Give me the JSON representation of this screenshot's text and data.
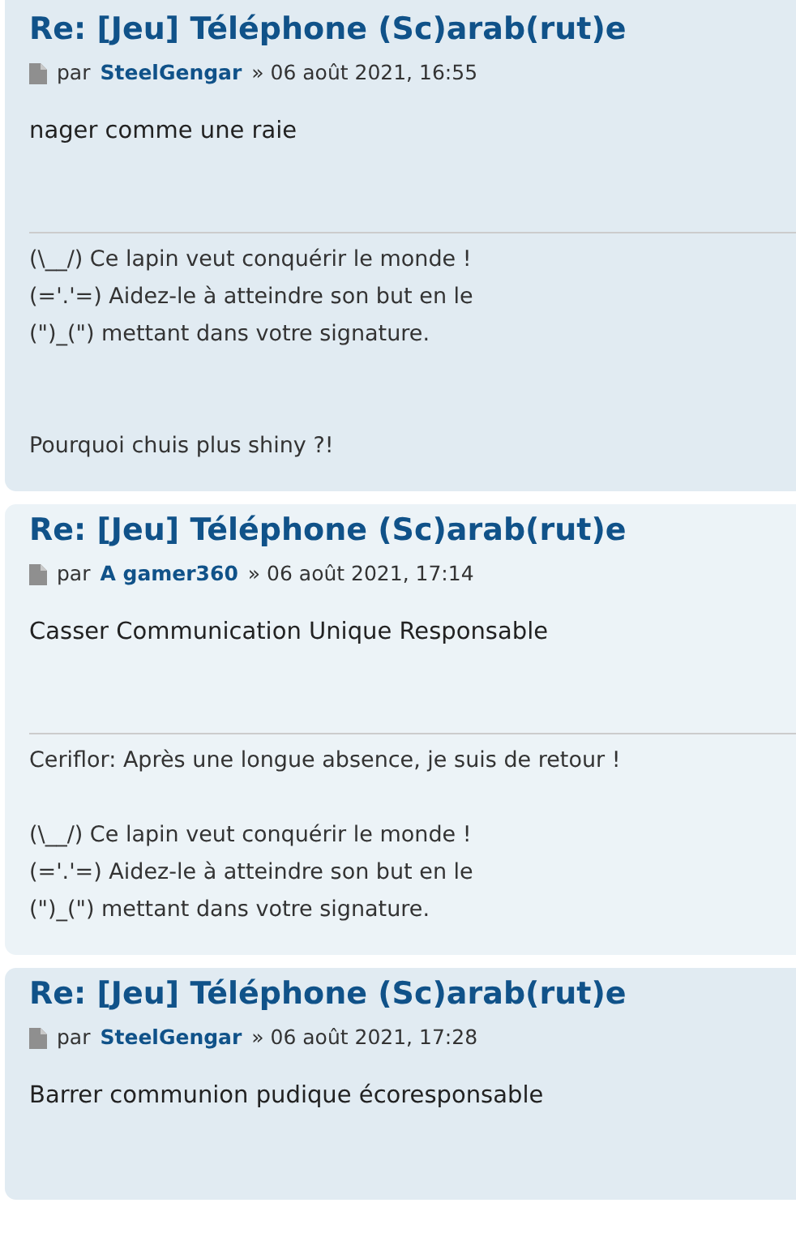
{
  "posts": [
    {
      "color": "#e1ebf2",
      "title": "Re: [Jeu] Téléphone (Sc)arab(rut)e",
      "by": "par",
      "author": "SteelGengar",
      "date": "» 06 août 2021, 16:55",
      "body": "nager comme une raie",
      "signature": [
        [
          "(\\__/) Ce lapin veut conquérir le monde !",
          "(='.'=) Aidez-le à atteindre son but en le",
          "(\")_(\") mettant dans votre signature."
        ],
        [
          "Pourquoi chuis plus shiny ?!"
        ]
      ]
    },
    {
      "color": "#ecf3f7",
      "title": "Re: [Jeu] Téléphone (Sc)arab(rut)e",
      "by": "par",
      "author": "A gamer360",
      "date": "» 06 août 2021, 17:14",
      "body": "Casser Communication Unique Responsable",
      "signature": [
        [
          "Ceriflor: Après une longue absence, je suis de retour !"
        ],
        [
          "(\\__/) Ce lapin veut conquérir le monde !",
          "(='.'=) Aidez-le à atteindre son but en le",
          "(\")_(\") mettant dans votre signature."
        ]
      ]
    },
    {
      "color": "#e1ebf2",
      "title": "Re: [Jeu] Téléphone (Sc)arab(rut)e",
      "by": "par",
      "author": "SteelGengar",
      "date": "» 06 août 2021, 17:28",
      "body": "Barrer communion pudique écoresponsable"
    }
  ]
}
